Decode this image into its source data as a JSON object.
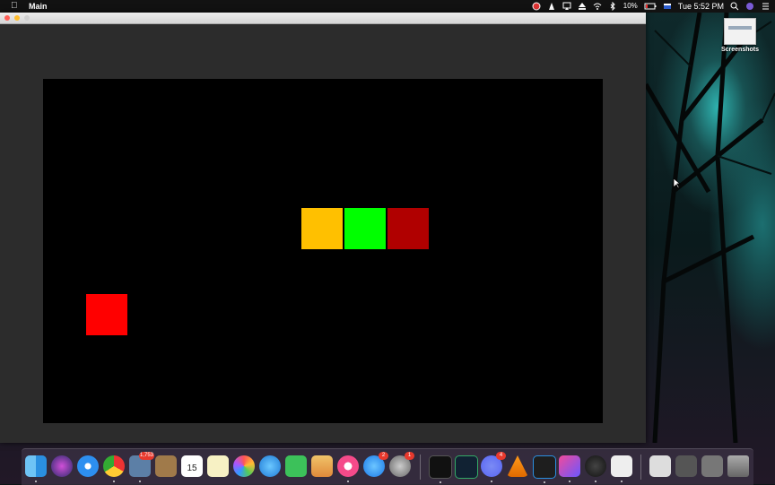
{
  "menubar": {
    "app_name": "Main",
    "battery_percent": "10%",
    "clock": "Tue 5:52 PM"
  },
  "desktop": {
    "folder_label": "Screenshots"
  },
  "game": {
    "blocks": [
      {
        "name": "snake-head-block",
        "color": "#ffc000"
      },
      {
        "name": "snake-body-block",
        "color": "#00ff00"
      },
      {
        "name": "snake-tail-block",
        "color": "#b00000"
      },
      {
        "name": "food-block",
        "color": "#ff0000"
      }
    ]
  },
  "dock": {
    "badges": {
      "photos_badge": "1,753",
      "app_store_badge": "2",
      "system_prefs_badge": "1",
      "discord_badge": "4"
    },
    "calendar_day": "15"
  }
}
